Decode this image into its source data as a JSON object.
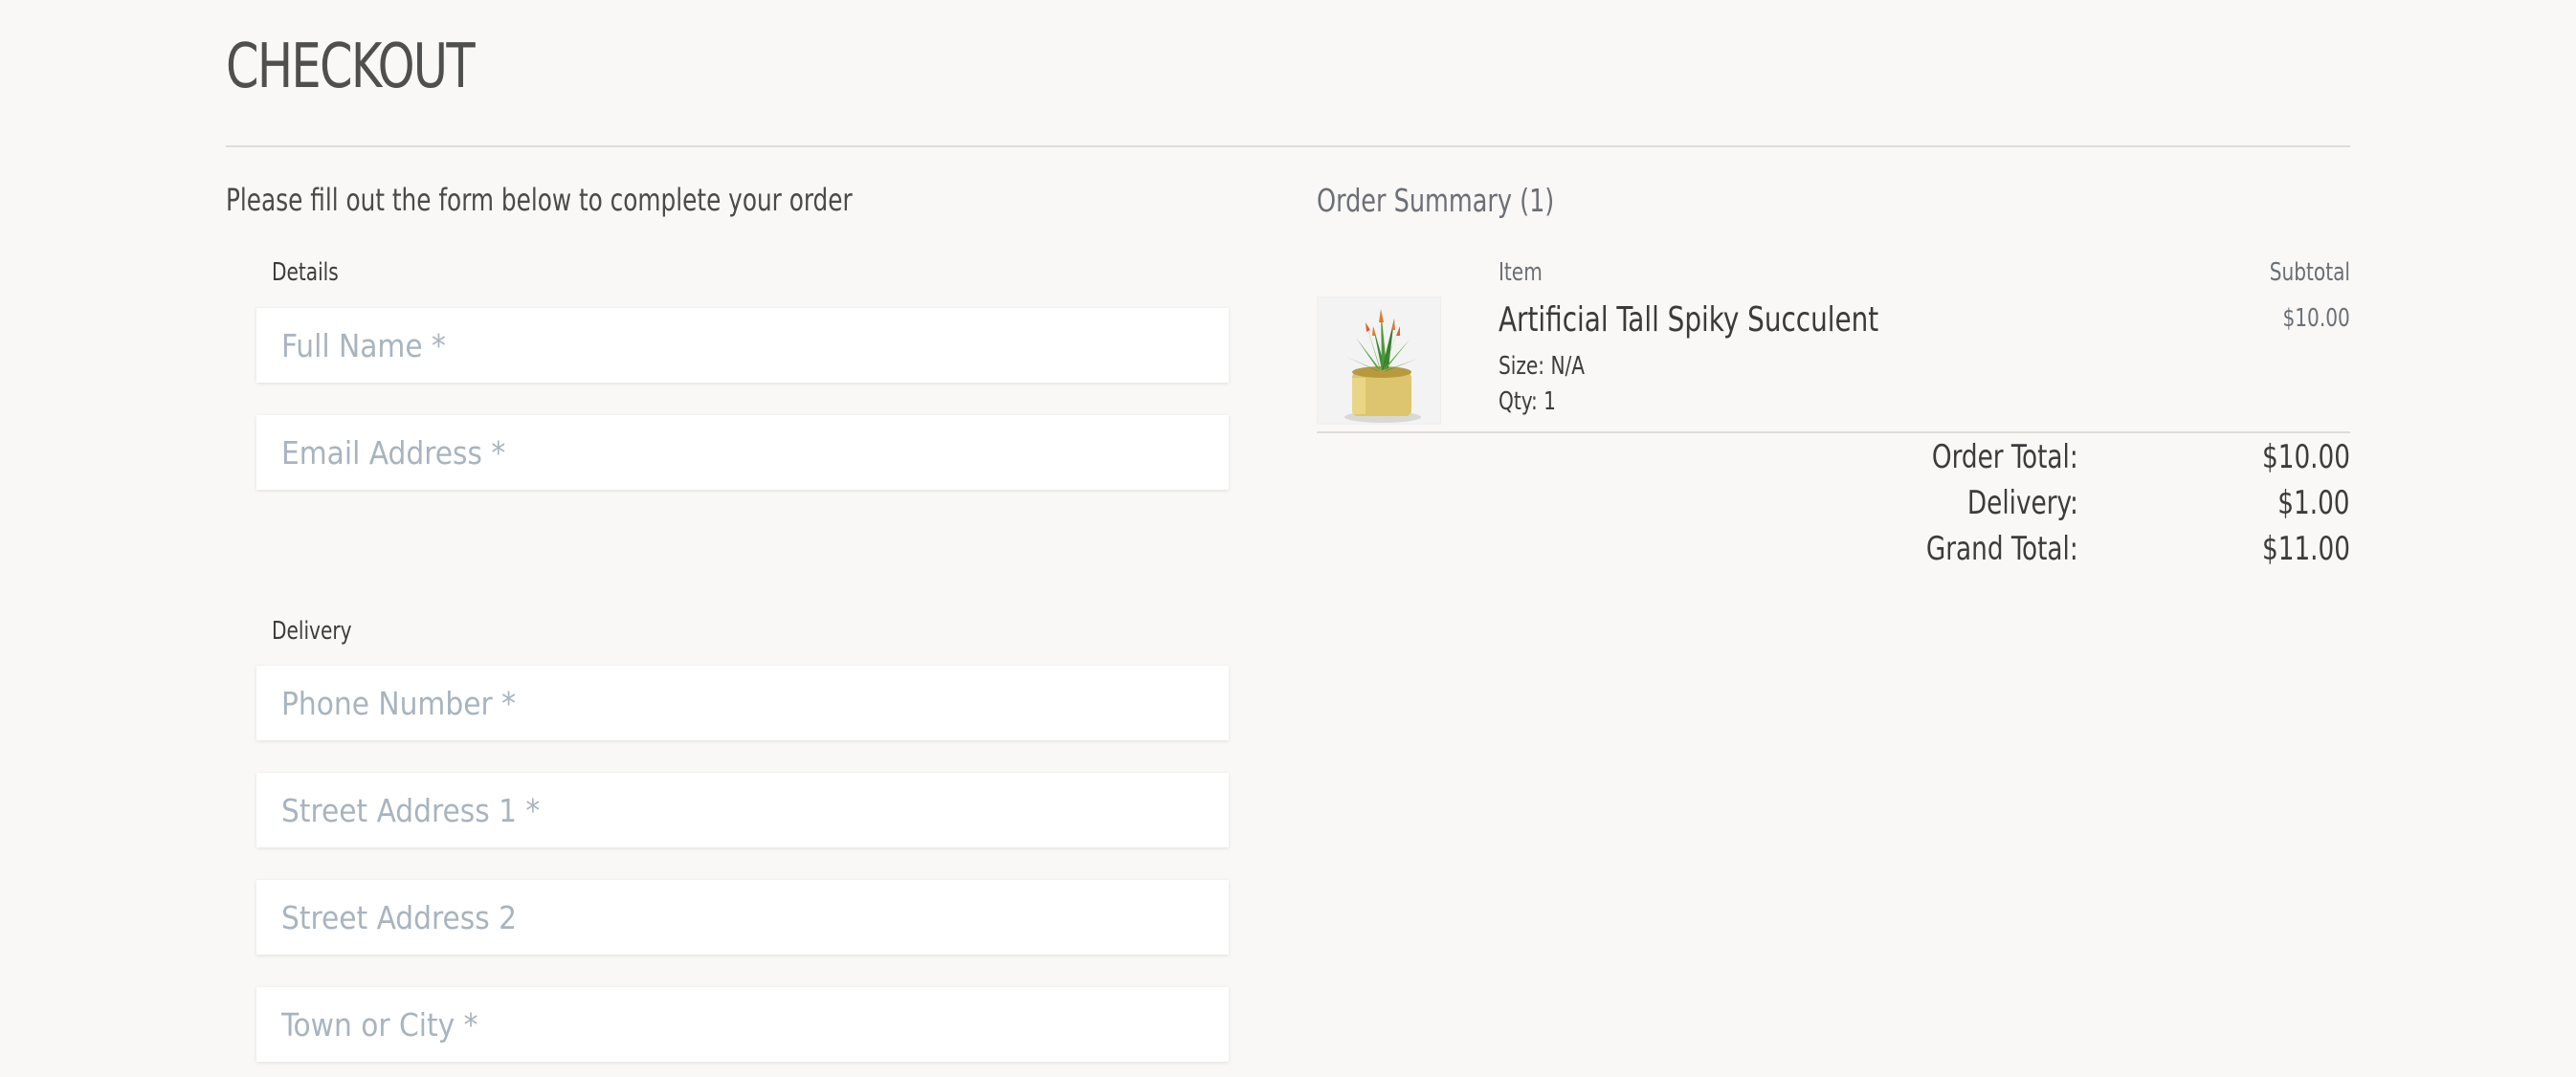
{
  "page": {
    "title": "CHECKOUT",
    "intro": "Please fill out the form below to complete your order"
  },
  "details": {
    "label": "Details",
    "full_name_placeholder": "Full Name *",
    "email_placeholder": "Email Address *"
  },
  "delivery": {
    "label": "Delivery",
    "phone_placeholder": "Phone Number *",
    "street1_placeholder": "Street Address 1 *",
    "street2_placeholder": "Street Address 2",
    "town_placeholder": "Town or City *"
  },
  "summary": {
    "title": "Order Summary (1)",
    "col_item": "Item",
    "col_subtotal": "Subtotal",
    "items": [
      {
        "name": "Artificial Tall Spiky Succulent",
        "size": "Size: N/A",
        "qty": "Qty: 1",
        "subtotal": "$10.00",
        "image_icon": "succulent-plant-image"
      }
    ],
    "order_total_label": "Order Total:",
    "order_total_value": "$10.00",
    "delivery_label": "Delivery:",
    "delivery_value": "$1.00",
    "grand_total_label": "Grand Total:",
    "grand_total_value": "$11.00"
  },
  "colors": {
    "background": "#f9f8f6",
    "text": "#4a4a4a",
    "muted": "#6b6f76",
    "placeholder": "#a8b4bf",
    "rule": "#dedcd8"
  }
}
